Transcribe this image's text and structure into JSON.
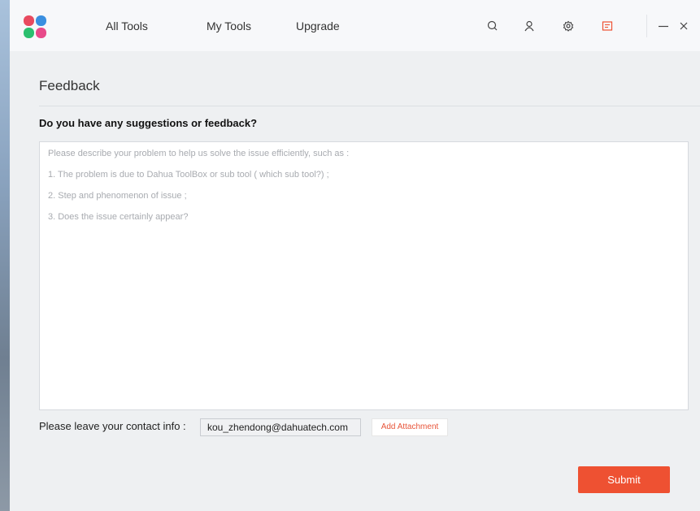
{
  "nav": {
    "items": [
      {
        "label": "All Tools"
      },
      {
        "label": "My Tools"
      },
      {
        "label": "Upgrade"
      }
    ]
  },
  "toolbar": {
    "icons": [
      "search-icon",
      "user-icon",
      "gear-icon",
      "notes-icon"
    ],
    "window_buttons": [
      "minimize-icon",
      "close-icon"
    ]
  },
  "page": {
    "title": "Feedback",
    "question": "Do you have any suggestions or feedback?",
    "placeholder_lines": [
      "Please describe your problem to help us solve the issue efficiently, such as :",
      "1. The problem is due to Dahua ToolBox or sub tool ( which sub tool?) ;",
      "2. Step and phenomenon of issue ;",
      "3. Does the issue certainly appear?"
    ],
    "contact_label": "Please leave your contact info :",
    "contact_value": "kou_zhendong@dahuatech.com",
    "attach_label": "Add Attachment",
    "submit_label": "Submit"
  },
  "colors": {
    "accent": "#ee5132",
    "logo": [
      "#e84a5f",
      "#3a8fe0",
      "#f5b02a",
      "#2bbf6e"
    ]
  }
}
